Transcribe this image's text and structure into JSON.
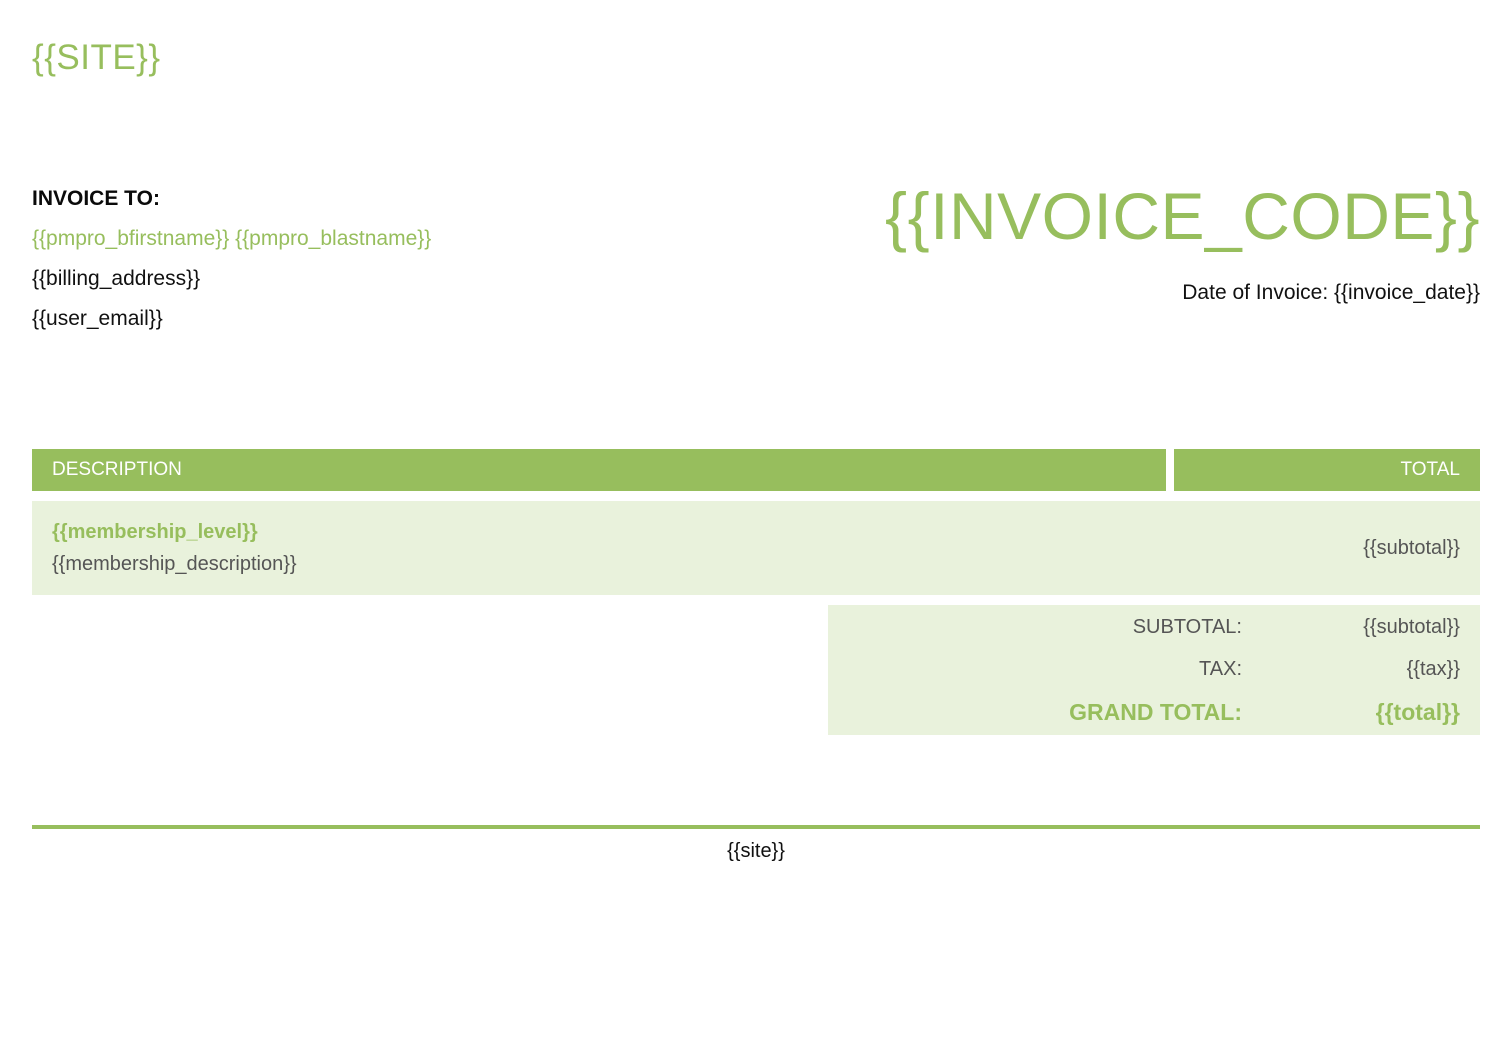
{
  "header": {
    "site": "{{SITE}}"
  },
  "bill_to": {
    "heading": "INVOICE TO:",
    "name": "{{pmpro_bfirstname}} {{pmpro_blastname}}",
    "address": "{{billing_address}}",
    "email": "{{user_email}}"
  },
  "invoice": {
    "code": "{{INVOICE_CODE}}",
    "date_line": "Date of Invoice: {{invoice_date}}"
  },
  "table": {
    "headers": {
      "description": "DESCRIPTION",
      "total": "TOTAL"
    },
    "items": [
      {
        "level": "{{membership_level}}",
        "description": "{{membership_description}}",
        "amount": "{{subtotal}}"
      }
    ]
  },
  "totals": {
    "subtotal_label": "SUBTOTAL:",
    "subtotal_value": "{{subtotal}}",
    "tax_label": "TAX:",
    "tax_value": "{{tax}}",
    "grand_label": "GRAND TOTAL:",
    "grand_value": "{{total}}"
  },
  "footer": {
    "site": "{{site}}"
  },
  "colors": {
    "accent": "#97be5d",
    "accent_light": "#e9f2dc",
    "muted_text": "#555555"
  }
}
